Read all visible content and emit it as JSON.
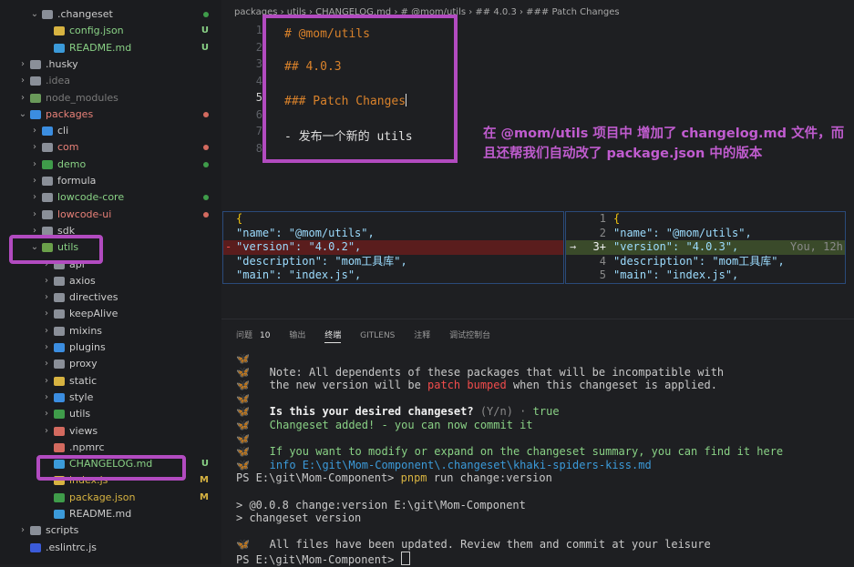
{
  "explorer": {
    "items": [
      {
        "label": ".changeset",
        "chev": "⌄",
        "status": "",
        "dot": "#3f9c4a",
        "color": "#cccccc",
        "icon": "#8a8f98"
      },
      {
        "label": "config.json",
        "chev": "",
        "status": "U",
        "dot": "",
        "color": "#89d185",
        "icon": "#d7b341"
      },
      {
        "label": "README.md",
        "chev": "",
        "status": "U",
        "dot": "",
        "color": "#89d185",
        "icon": "#3b9ad9"
      },
      {
        "label": ".husky",
        "chev": "›",
        "status": "",
        "dot": "",
        "color": "#cccccc",
        "icon": "#8a8f98"
      },
      {
        "label": ".idea",
        "chev": "›",
        "status": "",
        "dot": "",
        "color": "#7a7a7a",
        "icon": "#8a8f98"
      },
      {
        "label": "node_modules",
        "chev": "›",
        "status": "",
        "dot": "",
        "color": "#7a7a7a",
        "icon": "#6a9a5a"
      },
      {
        "label": "packages",
        "chev": "⌄",
        "status": "",
        "dot": "#d36a5f",
        "color": "#e88178",
        "icon": "#3b8de0"
      },
      {
        "label": "cli",
        "chev": "›",
        "status": "",
        "dot": "",
        "color": "#cccccc",
        "icon": "#3b8de0"
      },
      {
        "label": "com",
        "chev": "›",
        "status": "",
        "dot": "#d36a5f",
        "color": "#e88178",
        "icon": "#8a8f98"
      },
      {
        "label": "demo",
        "chev": "›",
        "status": "",
        "dot": "#3f9c4a",
        "color": "#89d185",
        "icon": "#3f9c4a"
      },
      {
        "label": "formula",
        "chev": "›",
        "status": "",
        "dot": "",
        "color": "#cccccc",
        "icon": "#8a8f98"
      },
      {
        "label": "lowcode-core",
        "chev": "›",
        "status": "",
        "dot": "#3f9c4a",
        "color": "#89d185",
        "icon": "#8a8f98"
      },
      {
        "label": "lowcode-ui",
        "chev": "›",
        "status": "",
        "dot": "#d36a5f",
        "color": "#e88178",
        "icon": "#8a8f98"
      },
      {
        "label": "sdk",
        "chev": "›",
        "status": "",
        "dot": "",
        "color": "#cccccc",
        "icon": "#8a8f98"
      },
      {
        "label": "utils",
        "chev": "⌄",
        "status": "",
        "dot": "",
        "color": "#89d185",
        "icon": "#6aa04a"
      },
      {
        "label": "api",
        "chev": "›",
        "status": "",
        "dot": "",
        "color": "#cccccc",
        "icon": "#8a8f98"
      },
      {
        "label": "axios",
        "chev": "›",
        "status": "",
        "dot": "",
        "color": "#cccccc",
        "icon": "#8a8f98"
      },
      {
        "label": "directives",
        "chev": "›",
        "status": "",
        "dot": "",
        "color": "#cccccc",
        "icon": "#8a8f98"
      },
      {
        "label": "keepAlive",
        "chev": "›",
        "status": "",
        "dot": "",
        "color": "#cccccc",
        "icon": "#8a8f98"
      },
      {
        "label": "mixins",
        "chev": "›",
        "status": "",
        "dot": "",
        "color": "#cccccc",
        "icon": "#8a8f98"
      },
      {
        "label": "plugins",
        "chev": "›",
        "status": "",
        "dot": "",
        "color": "#cccccc",
        "icon": "#3b8de0"
      },
      {
        "label": "proxy",
        "chev": "›",
        "status": "",
        "dot": "",
        "color": "#cccccc",
        "icon": "#8a8f98"
      },
      {
        "label": "static",
        "chev": "›",
        "status": "",
        "dot": "",
        "color": "#cccccc",
        "icon": "#d7b341"
      },
      {
        "label": "style",
        "chev": "›",
        "status": "",
        "dot": "",
        "color": "#cccccc",
        "icon": "#3b8de0"
      },
      {
        "label": "utils",
        "chev": "›",
        "status": "",
        "dot": "",
        "color": "#cccccc",
        "icon": "#3f9c4a"
      },
      {
        "label": "views",
        "chev": "›",
        "status": "",
        "dot": "",
        "color": "#cccccc",
        "icon": "#d36a5f"
      },
      {
        "label": ".npmrc",
        "chev": "",
        "status": "",
        "dot": "",
        "color": "#cccccc",
        "icon": "#d36a5f"
      },
      {
        "label": "CHANGELOG.md",
        "chev": "",
        "status": "U",
        "dot": "",
        "color": "#89d185",
        "icon": "#3b9ad9"
      },
      {
        "label": "index.js",
        "chev": "",
        "status": "M",
        "dot": "",
        "color": "#d7b341",
        "icon": "#d7b341"
      },
      {
        "label": "package.json",
        "chev": "",
        "status": "M",
        "dot": "",
        "color": "#d7b341",
        "icon": "#3f9c4a"
      },
      {
        "label": "README.md",
        "chev": "",
        "status": "",
        "dot": "",
        "color": "#cccccc",
        "icon": "#3b9ad9"
      },
      {
        "label": "scripts",
        "chev": "›",
        "status": "",
        "dot": "",
        "color": "#cccccc",
        "icon": "#8a8f98"
      },
      {
        "label": ".eslintrc.js",
        "chev": "",
        "status": "",
        "dot": "",
        "color": "#cccccc",
        "icon": "#3b5bd9"
      }
    ]
  },
  "editor": {
    "breadcrumb": "packages › utils › CHANGELOG.md › # @mom/utils › ## 4.0.3 › ### Patch Changes",
    "line_numbers": [
      "1",
      "2",
      "3",
      "4",
      "5",
      "6",
      "7",
      "8"
    ],
    "popup_lines": [
      "# @mom/utils",
      "## 4.0.3",
      "### Patch Changes",
      "- 发布一个新的 utils"
    ],
    "annotation": "在 @mom/utils 项目中 增加了 changelog.md 文件，而且还帮我们自动改了 package.json 中的版本"
  },
  "diff": {
    "left": [
      "{",
      "  \"name\": \"@mom/utils\",",
      "  \"version\": \"4.0.2\",",
      "  \"description\": \"mom工具库\",",
      "  \"main\": \"index.js\","
    ],
    "right_nums": [
      "1",
      "2",
      "3+",
      "4",
      "5"
    ],
    "right": [
      "{",
      "  \"name\": \"@mom/utils\",",
      "  \"version\": \"4.0.3\",",
      "  \"description\": \"mom工具库\",",
      "  \"main\": \"index.js\","
    ],
    "blame": "You, 12h",
    "arrow": "→",
    "minus": "-"
  },
  "panel": {
    "tabs": [
      "问题",
      "10",
      "输出",
      "终端",
      "GITLENS",
      "注释",
      "调试控制台"
    ],
    "terminal": {
      "note1": "Note: All dependents of these packages that will be incompatible with",
      "note2a": "the new version will be ",
      "note2b": "patch bumped",
      "note2c": " when this changeset is applied.",
      "q": "Is this your desired changeset?",
      "q_opts": " (Y/n) · ",
      "q_ans": "true",
      "added": "Changeset added! - you can now commit it",
      "modify": "If you want to modify or expand on the changeset summary, you can find it here",
      "info": "info",
      "info_path": " E:\\git\\Mom-Component\\.changeset\\khaki-spiders-kiss.md",
      "ps1a": "PS E:\\git\\Mom-Component> ",
      "ps1b": "pnpm",
      "ps1c": " run change:version",
      "out1": "> @0.0.8 change:version E:\\git\\Mom-Component",
      "out2": "> changeset version",
      "done": "All files have been updated. Review them and commit at your leisure",
      "ps2": "PS E:\\git\\Mom-Component> "
    }
  }
}
